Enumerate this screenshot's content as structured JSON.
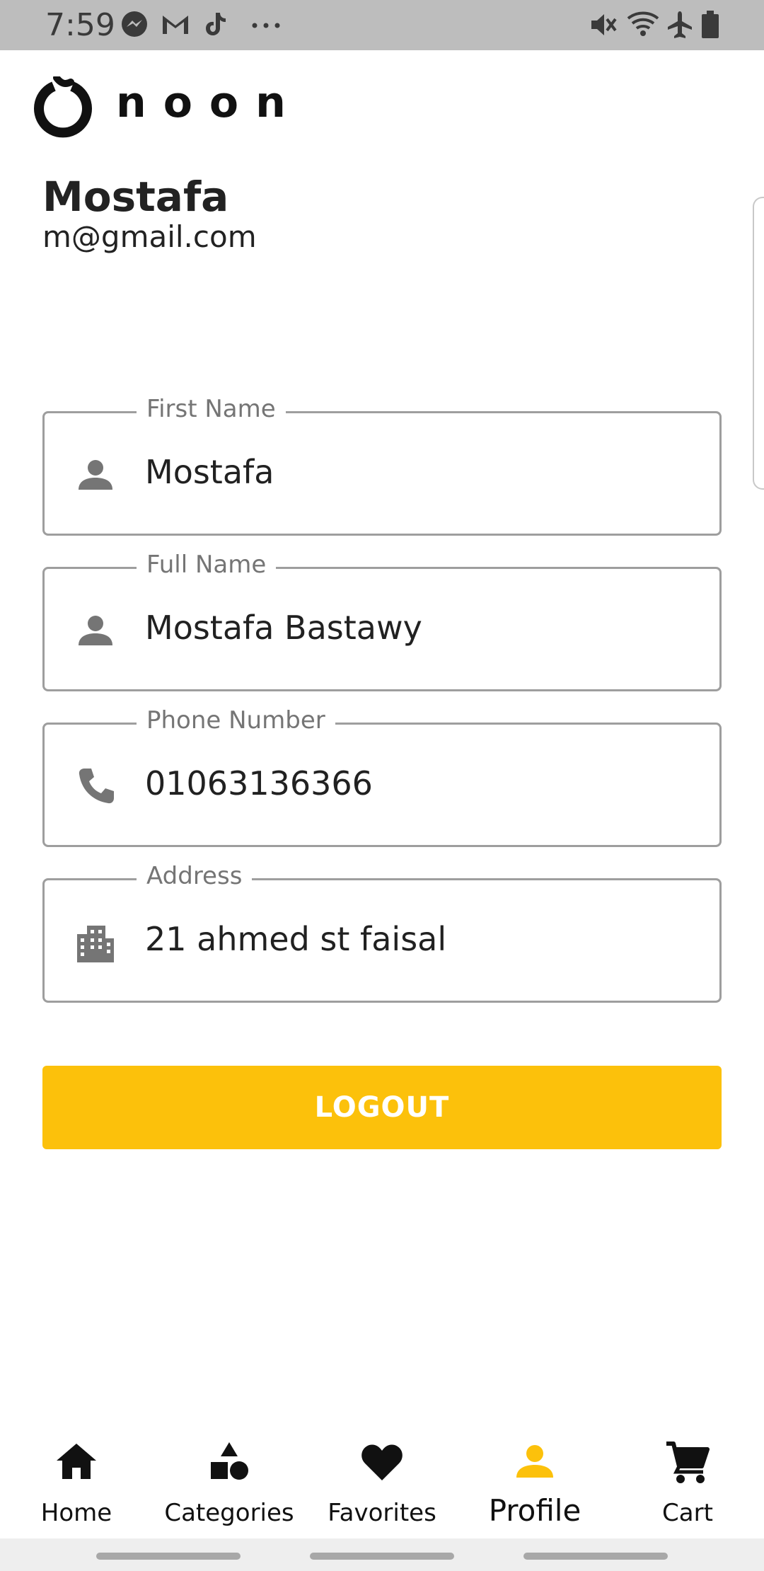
{
  "status_bar": {
    "time": "7:59",
    "left_icons": [
      "messenger-icon",
      "gmail-icon",
      "tiktok-icon",
      "more-icon"
    ],
    "right_icons": [
      "mute-icon",
      "wifi-icon",
      "airplane-icon",
      "battery-icon"
    ]
  },
  "brand": {
    "logo_text": "noon"
  },
  "profile": {
    "name": "Mostafa",
    "email": "m@gmail.com"
  },
  "fields": [
    {
      "label": "First Name",
      "value": "Mostafa",
      "icon": "person-icon"
    },
    {
      "label": "Full Name",
      "value": "Mostafa Bastawy",
      "icon": "person-icon"
    },
    {
      "label": "Phone Number",
      "value": "01063136366",
      "icon": "phone-icon"
    },
    {
      "label": "Address",
      "value": "21 ahmed st faisal",
      "icon": "building-icon"
    }
  ],
  "actions": {
    "logout_label": "LOGOUT"
  },
  "bottom_nav": [
    {
      "label": "Home",
      "icon": "home-icon",
      "active": false
    },
    {
      "label": "Categories",
      "icon": "categories-icon",
      "active": false
    },
    {
      "label": "Favorites",
      "icon": "heart-icon",
      "active": false
    },
    {
      "label": "Profile",
      "icon": "person-icon",
      "active": true
    },
    {
      "label": "Cart",
      "icon": "cart-icon",
      "active": false
    }
  ],
  "colors": {
    "accent": "#fcc10b",
    "status_bar": "#bdbdbd",
    "field_border": "#9e9e9e",
    "label_gray": "#757575",
    "icon_gray": "#757575"
  }
}
